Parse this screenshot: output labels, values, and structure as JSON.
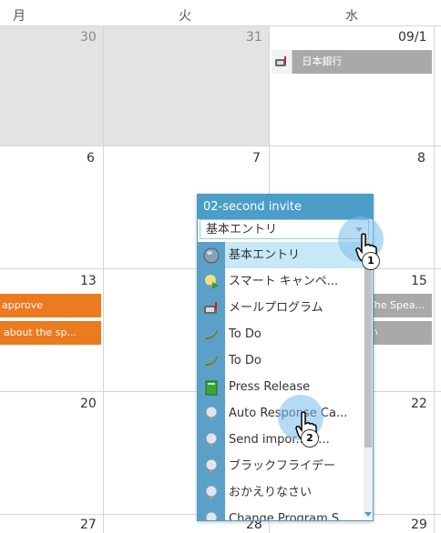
{
  "weekdays": [
    "月",
    "火",
    "水"
  ],
  "days": {
    "r1": [
      "30",
      "31",
      "09/1"
    ],
    "r2": [
      "6",
      "7",
      "8"
    ],
    "r3": [
      "13",
      "15"
    ],
    "r4": [
      "20",
      "22"
    ],
    "r5": [
      "27",
      "28",
      "29"
    ]
  },
  "events": {
    "bank": "日本銀行",
    "approve": "approve",
    "about": "about the sp...",
    "speaker": "The Spea...",
    "right_small": "い"
  },
  "popup": {
    "title": "02-second invite",
    "combo_value": "基本エントリ",
    "items": [
      {
        "label": "基本エントリ",
        "icon": "globe-icon"
      },
      {
        "label": "スマート キャンペ...",
        "icon": "smart-campaign-icon"
      },
      {
        "label": "メールプログラム",
        "icon": "mailbox-icon"
      },
      {
        "label": "To Do",
        "icon": "banana-icon"
      },
      {
        "label": "To Do",
        "icon": "banana-icon"
      },
      {
        "label": "Press Release",
        "icon": "book-icon"
      },
      {
        "label": "Auto Response Ca...",
        "icon": "lightbulb-icon"
      },
      {
        "label": "Send impor...gr...",
        "icon": "lightbulb-icon"
      },
      {
        "label": "ブラックフライデー",
        "icon": "lightbulb-icon"
      },
      {
        "label": "おかえりなさい",
        "icon": "lightbulb-icon"
      },
      {
        "label": "Change Program S...",
        "icon": "lightbulb-icon"
      }
    ]
  },
  "markers": {
    "first": "1",
    "second": "2"
  },
  "colors": {
    "accent": "#4a9ec8",
    "event_orange": "#ec7a1f",
    "event_gray": "#a9a9a9",
    "selected_row": "#c7e8f7"
  }
}
